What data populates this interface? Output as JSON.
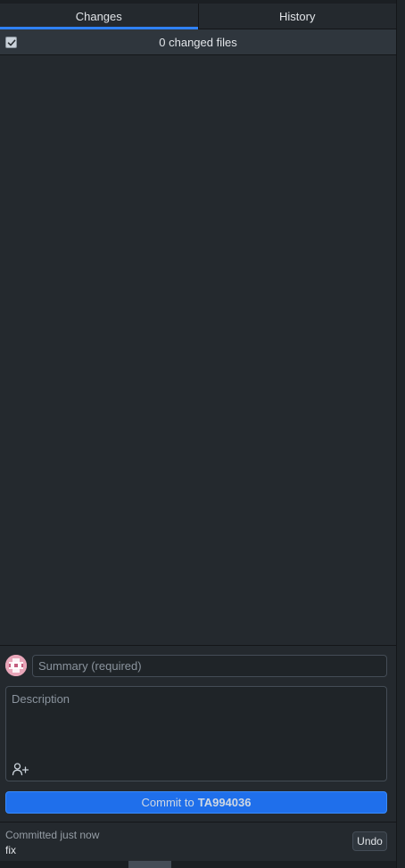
{
  "tabs": [
    {
      "label": "Changes",
      "active": true
    },
    {
      "label": "History",
      "active": false
    }
  ],
  "changes_header": {
    "select_all_checked": true,
    "changed_count_label": "0 changed files"
  },
  "commit": {
    "summary_placeholder": "Summary (required)",
    "summary_value": "",
    "description_placeholder": "Description",
    "description_value": "",
    "button_prefix": "Commit to",
    "branch": "TA994036"
  },
  "undo": {
    "status": "Committed just now",
    "summary": "fix",
    "button_label": "Undo"
  },
  "colors": {
    "background": "#24292e",
    "accent": "#2f81f7",
    "commit_button": "#1f6feb",
    "avatar": "#e8a6b9"
  },
  "icons": {
    "checkbox": "check-icon",
    "avatar": "avatar-icon",
    "coauthor": "add-coauthor-icon"
  }
}
